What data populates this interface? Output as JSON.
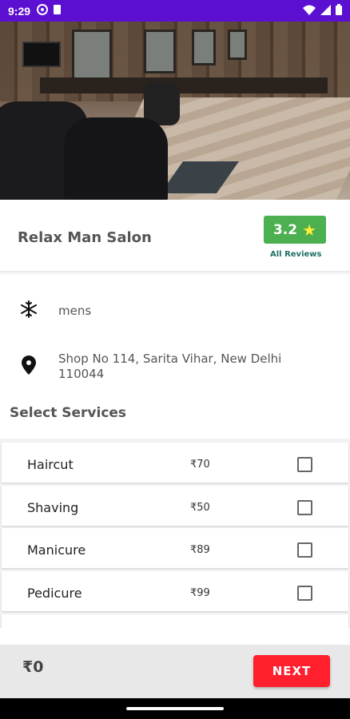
{
  "status_bar": {
    "time": "9:29",
    "left_icons": [
      "settings-icon",
      "clipboard-icon"
    ],
    "right_icons": [
      "wifi-icon",
      "signal-icon",
      "battery-icon"
    ],
    "color": "#5b0fd0"
  },
  "hero": {
    "description_icon": "salon-photo"
  },
  "salon": {
    "name": "Relax Man Salon",
    "rating": "3.2",
    "rating_icon": "star-icon",
    "reviews_link": "All Reviews",
    "rating_color": "#4caf50"
  },
  "info": {
    "category": "mens",
    "category_icon": "snowflake-icon",
    "address": "Shop No 114, Sarita Vihar, New Delhi 110044",
    "address_icon": "location-pin-icon"
  },
  "services_section": {
    "title": "Select Services",
    "items": [
      {
        "name": "Haircut",
        "price": "₹70",
        "checked": false
      },
      {
        "name": "Shaving",
        "price": "₹50",
        "checked": false
      },
      {
        "name": "Manicure",
        "price": "₹89",
        "checked": false
      },
      {
        "name": "Pedicure",
        "price": "₹99",
        "checked": false
      }
    ]
  },
  "footer": {
    "total": "₹0",
    "next_label": "NEXT",
    "next_color": "#ff1f2d"
  }
}
